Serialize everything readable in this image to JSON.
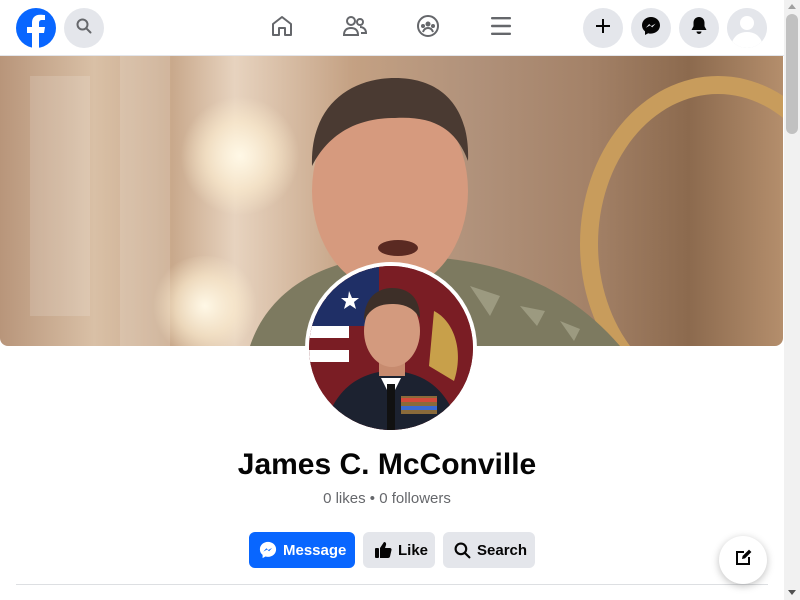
{
  "nav": {
    "logo": "facebook-logo",
    "search_icon": "search-icon",
    "center_icons": [
      "home-icon",
      "friends-icon",
      "groups-icon",
      "menu-icon"
    ],
    "right_icons": [
      "plus-icon",
      "messenger-icon",
      "bell-icon",
      "account-avatar"
    ]
  },
  "profile": {
    "name": "James C. McConville",
    "stats": "0 likes • 0 followers"
  },
  "actions": {
    "message_label": "Message",
    "like_label": "Like",
    "search_label": "Search"
  },
  "colors": {
    "brand_blue": "#0866ff",
    "button_gray": "#e4e6eb",
    "text_primary": "#050505",
    "text_secondary": "#65676b"
  }
}
